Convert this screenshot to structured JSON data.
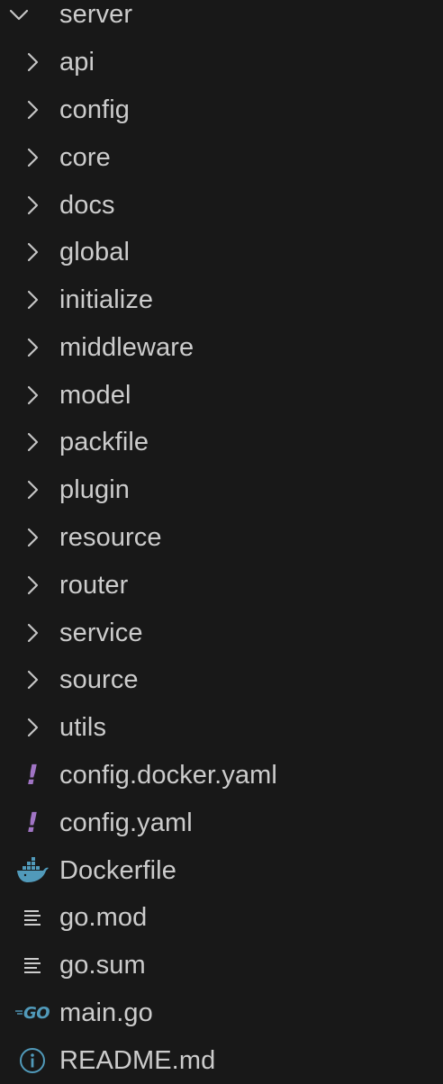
{
  "explorer": {
    "root": {
      "label": "server",
      "expanded": true,
      "icon": "chevron-down-icon"
    },
    "folders": [
      {
        "label": "api",
        "icon": "chevron-right-icon"
      },
      {
        "label": "config",
        "icon": "chevron-right-icon"
      },
      {
        "label": "core",
        "icon": "chevron-right-icon"
      },
      {
        "label": "docs",
        "icon": "chevron-right-icon"
      },
      {
        "label": "global",
        "icon": "chevron-right-icon"
      },
      {
        "label": "initialize",
        "icon": "chevron-right-icon"
      },
      {
        "label": "middleware",
        "icon": "chevron-right-icon"
      },
      {
        "label": "model",
        "icon": "chevron-right-icon"
      },
      {
        "label": "packfile",
        "icon": "chevron-right-icon"
      },
      {
        "label": "plugin",
        "icon": "chevron-right-icon"
      },
      {
        "label": "resource",
        "icon": "chevron-right-icon"
      },
      {
        "label": "router",
        "icon": "chevron-right-icon"
      },
      {
        "label": "service",
        "icon": "chevron-right-icon"
      },
      {
        "label": "source",
        "icon": "chevron-right-icon"
      },
      {
        "label": "utils",
        "icon": "chevron-right-icon"
      }
    ],
    "files": [
      {
        "label": "config.docker.yaml",
        "icon": "yaml-icon",
        "glyph": "!",
        "color": "#a074c4"
      },
      {
        "label": "config.yaml",
        "icon": "yaml-icon",
        "glyph": "!",
        "color": "#a074c4"
      },
      {
        "label": "Dockerfile",
        "icon": "docker-icon",
        "color": "#519aba"
      },
      {
        "label": "go.mod",
        "icon": "lines-icon",
        "color": "#cccccc"
      },
      {
        "label": "go.sum",
        "icon": "lines-icon",
        "color": "#cccccc"
      },
      {
        "label": "main.go",
        "icon": "go-icon",
        "glyph": "GO",
        "color": "#519aba"
      },
      {
        "label": "README.md",
        "icon": "info-icon",
        "color": "#519aba"
      }
    ]
  },
  "colors": {
    "background": "#181818",
    "text": "#cccccc",
    "chevron": "#c5c5c5"
  }
}
